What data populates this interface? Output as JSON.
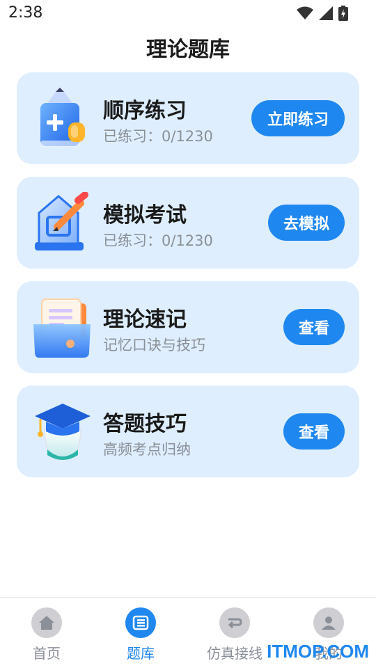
{
  "status": {
    "time": "2:38"
  },
  "page": {
    "title": "理论题库"
  },
  "cards": [
    {
      "title": "顺序练习",
      "subtitle": "已练习：0/1230",
      "button": "立即练习",
      "icon": "pencil-icon"
    },
    {
      "title": "模拟考试",
      "subtitle": "已练习：0/1230",
      "button": "去模拟",
      "icon": "exam-icon"
    },
    {
      "title": "理论速记",
      "subtitle": "记忆口诀与技巧",
      "button": "查看",
      "icon": "notes-icon"
    },
    {
      "title": "答题技巧",
      "subtitle": "高频考点归纳",
      "button": "查看",
      "icon": "graduation-cap-icon"
    }
  ],
  "nav": [
    {
      "label": "首页",
      "icon": "home-icon",
      "active": false
    },
    {
      "label": "题库",
      "icon": "list-icon",
      "active": true
    },
    {
      "label": "仿真接线",
      "icon": "route-icon",
      "active": false
    },
    {
      "label": "我的",
      "icon": "user-icon",
      "active": false
    }
  ],
  "watermark": "ITMOP.COM",
  "colors": {
    "accent": "#1f87f0",
    "card_bg": "#deeefe",
    "muted": "#8a8f98"
  }
}
